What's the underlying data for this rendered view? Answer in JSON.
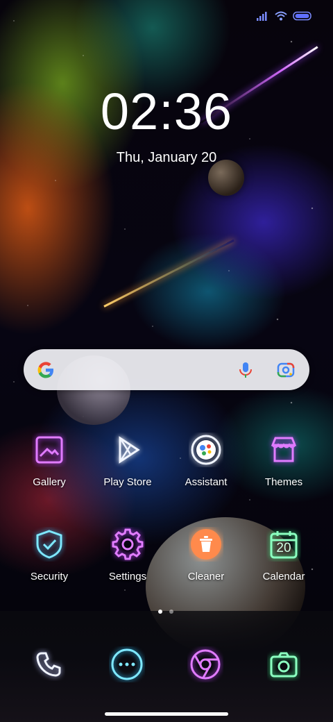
{
  "lock": {
    "time": "02:36",
    "date": "Thu, January 20"
  },
  "search": {
    "google_icon": "google-g-icon",
    "mic_icon": "mic-icon",
    "lens_icon": "lens-icon"
  },
  "apps": [
    {
      "label": "Gallery",
      "icon": "gallery-icon"
    },
    {
      "label": "Play Store",
      "icon": "play-store-icon"
    },
    {
      "label": "Assistant",
      "icon": "assistant-icon"
    },
    {
      "label": "Themes",
      "icon": "themes-icon"
    },
    {
      "label": "Security",
      "icon": "security-shield-icon"
    },
    {
      "label": "Settings",
      "icon": "gear-icon"
    },
    {
      "label": "Cleaner",
      "icon": "trash-icon"
    },
    {
      "label": "Calendar",
      "icon": "calendar-icon",
      "day": "20"
    }
  ],
  "dock": [
    {
      "icon": "phone-icon"
    },
    {
      "icon": "more-apps-icon"
    },
    {
      "icon": "chrome-icon"
    },
    {
      "icon": "camera-icon"
    }
  ],
  "pages": {
    "count": 2,
    "current": 1
  },
  "colors": {
    "neon_pink": "#e17cff",
    "neon_cyan": "#7fe8ff",
    "neon_green": "#8bffc0",
    "neon_white": "#f0f4ff",
    "cleaner_orange": "#ff8a4c"
  }
}
